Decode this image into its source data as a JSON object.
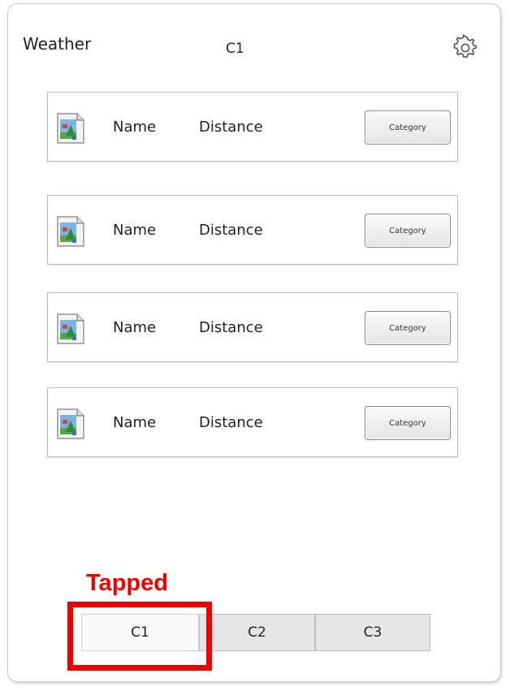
{
  "header": {
    "title": "Weather",
    "screen_label": "C1",
    "settings_icon": "gear-icon"
  },
  "items": [
    {
      "icon": "image-file-icon",
      "name": "Name",
      "distance": "Distance",
      "category_label": "Category"
    },
    {
      "icon": "image-file-icon",
      "name": "Name",
      "distance": "Distance",
      "category_label": "Category"
    },
    {
      "icon": "image-file-icon",
      "name": "Name",
      "distance": "Distance",
      "category_label": "Category"
    },
    {
      "icon": "image-file-icon",
      "name": "Name",
      "distance": "Distance",
      "category_label": "Category"
    }
  ],
  "annotation": {
    "label": "Tapped",
    "color": "#f00000"
  },
  "tabs": [
    {
      "label": "C1",
      "active": true
    },
    {
      "label": "C2",
      "active": false
    },
    {
      "label": "C3",
      "active": false
    }
  ]
}
